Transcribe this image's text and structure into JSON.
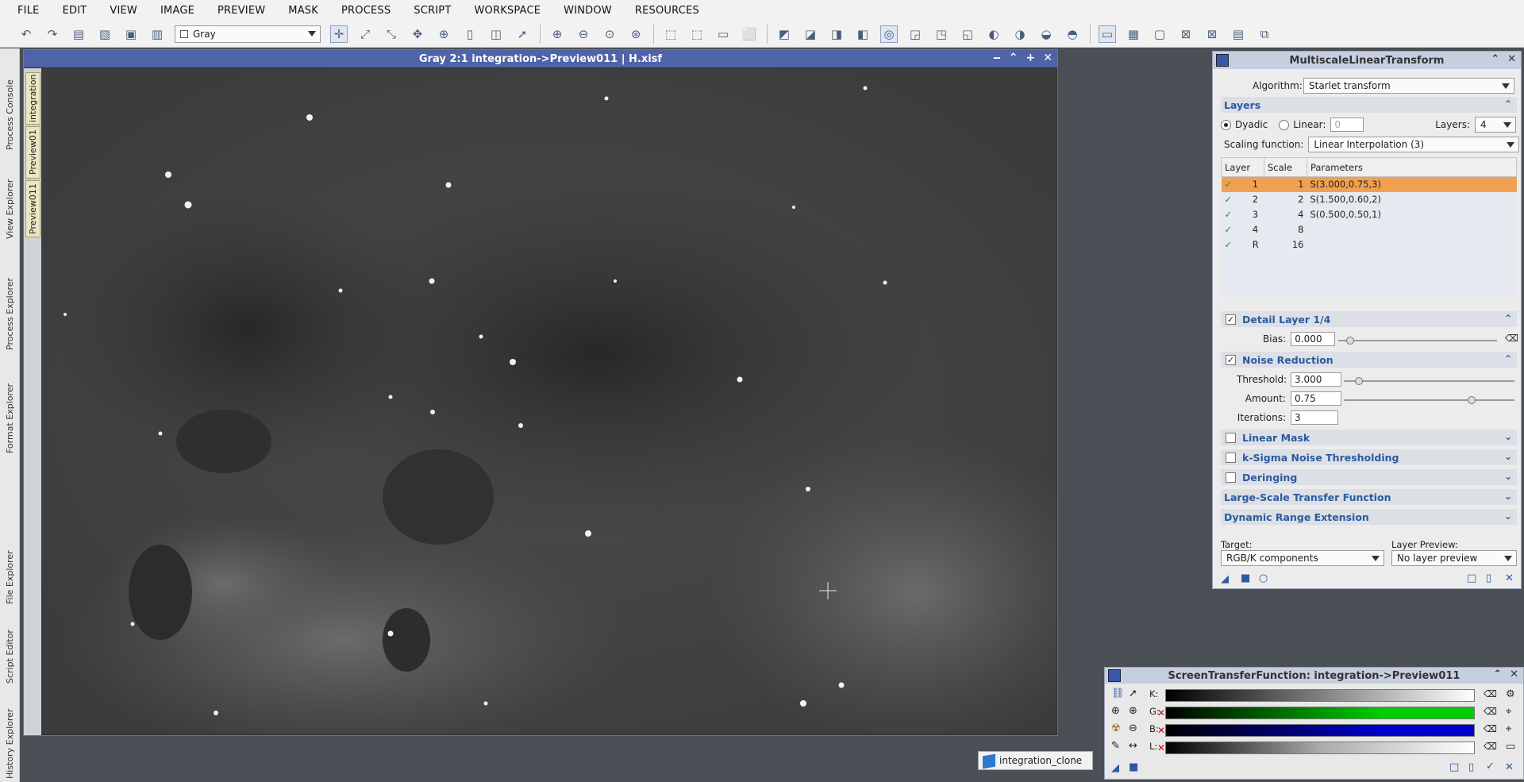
{
  "menu": [
    "FILE",
    "EDIT",
    "VIEW",
    "IMAGE",
    "PREVIEW",
    "MASK",
    "PROCESS",
    "SCRIPT",
    "WORKSPACE",
    "WINDOW",
    "RESOURCES"
  ],
  "toolbar": {
    "colorspace_combo": "Gray"
  },
  "left_dock": {
    "tabs": [
      "Process Console",
      "View Explorer",
      "Process Explorer",
      "Format Explorer",
      "File Explorer",
      "Script Editor",
      "History Explorer"
    ]
  },
  "view_tabs": [
    "integration",
    "Preview01",
    "Preview011"
  ],
  "image_window": {
    "title": "Gray 2:1 integration->Preview011 | H.xisf"
  },
  "mlt": {
    "title": "MultiscaleLinearTransform",
    "algorithm_label": "Algorithm:",
    "algorithm_value": "Starlet transform",
    "layers_section": "Layers",
    "dyadic_label": "Dyadic",
    "linear_label": "Linear:",
    "linear_value": "0",
    "layers_label": "Layers:",
    "layers_value": "4",
    "scaling_label": "Scaling function:",
    "scaling_value": "Linear Interpolation (3)",
    "table_headers": [
      "Layer",
      "Scale",
      "Parameters"
    ],
    "table_rows": [
      {
        "layer": "1",
        "scale": "1",
        "params": "S(3.000,0.75,3)"
      },
      {
        "layer": "2",
        "scale": "2",
        "params": "S(1.500,0.60,2)"
      },
      {
        "layer": "3",
        "scale": "4",
        "params": "S(0.500,0.50,1)"
      },
      {
        "layer": "4",
        "scale": "8",
        "params": ""
      },
      {
        "layer": "R",
        "scale": "16",
        "params": ""
      }
    ],
    "detail_layer": "Detail Layer 1/4",
    "bias_label": "Bias:",
    "bias_value": "0.000",
    "noise_reduction": "Noise Reduction",
    "threshold_label": "Threshold:",
    "threshold_value": "3.000",
    "amount_label": "Amount:",
    "amount_value": "0.75",
    "iterations_label": "Iterations:",
    "iterations_value": "3",
    "linear_mask": "Linear Mask",
    "ksigma": "k-Sigma Noise Thresholding",
    "deringing": "Deringing",
    "lstf": "Large-Scale Transfer Function",
    "dre": "Dynamic Range Extension",
    "target_label": "Target:",
    "target_value": "RGB/K components",
    "layer_preview_label": "Layer Preview:",
    "layer_preview_value": "No layer preview"
  },
  "stf": {
    "title": "ScreenTransferFunction: integration->Preview011",
    "channels": [
      "K:",
      "G:",
      "B:",
      "L:"
    ]
  },
  "taskbar": {
    "label": "integration_clone"
  },
  "colors": {
    "title_blue": "#4e63a8",
    "selected_row": "#f0a050",
    "section_text": "#2c5aa0"
  }
}
